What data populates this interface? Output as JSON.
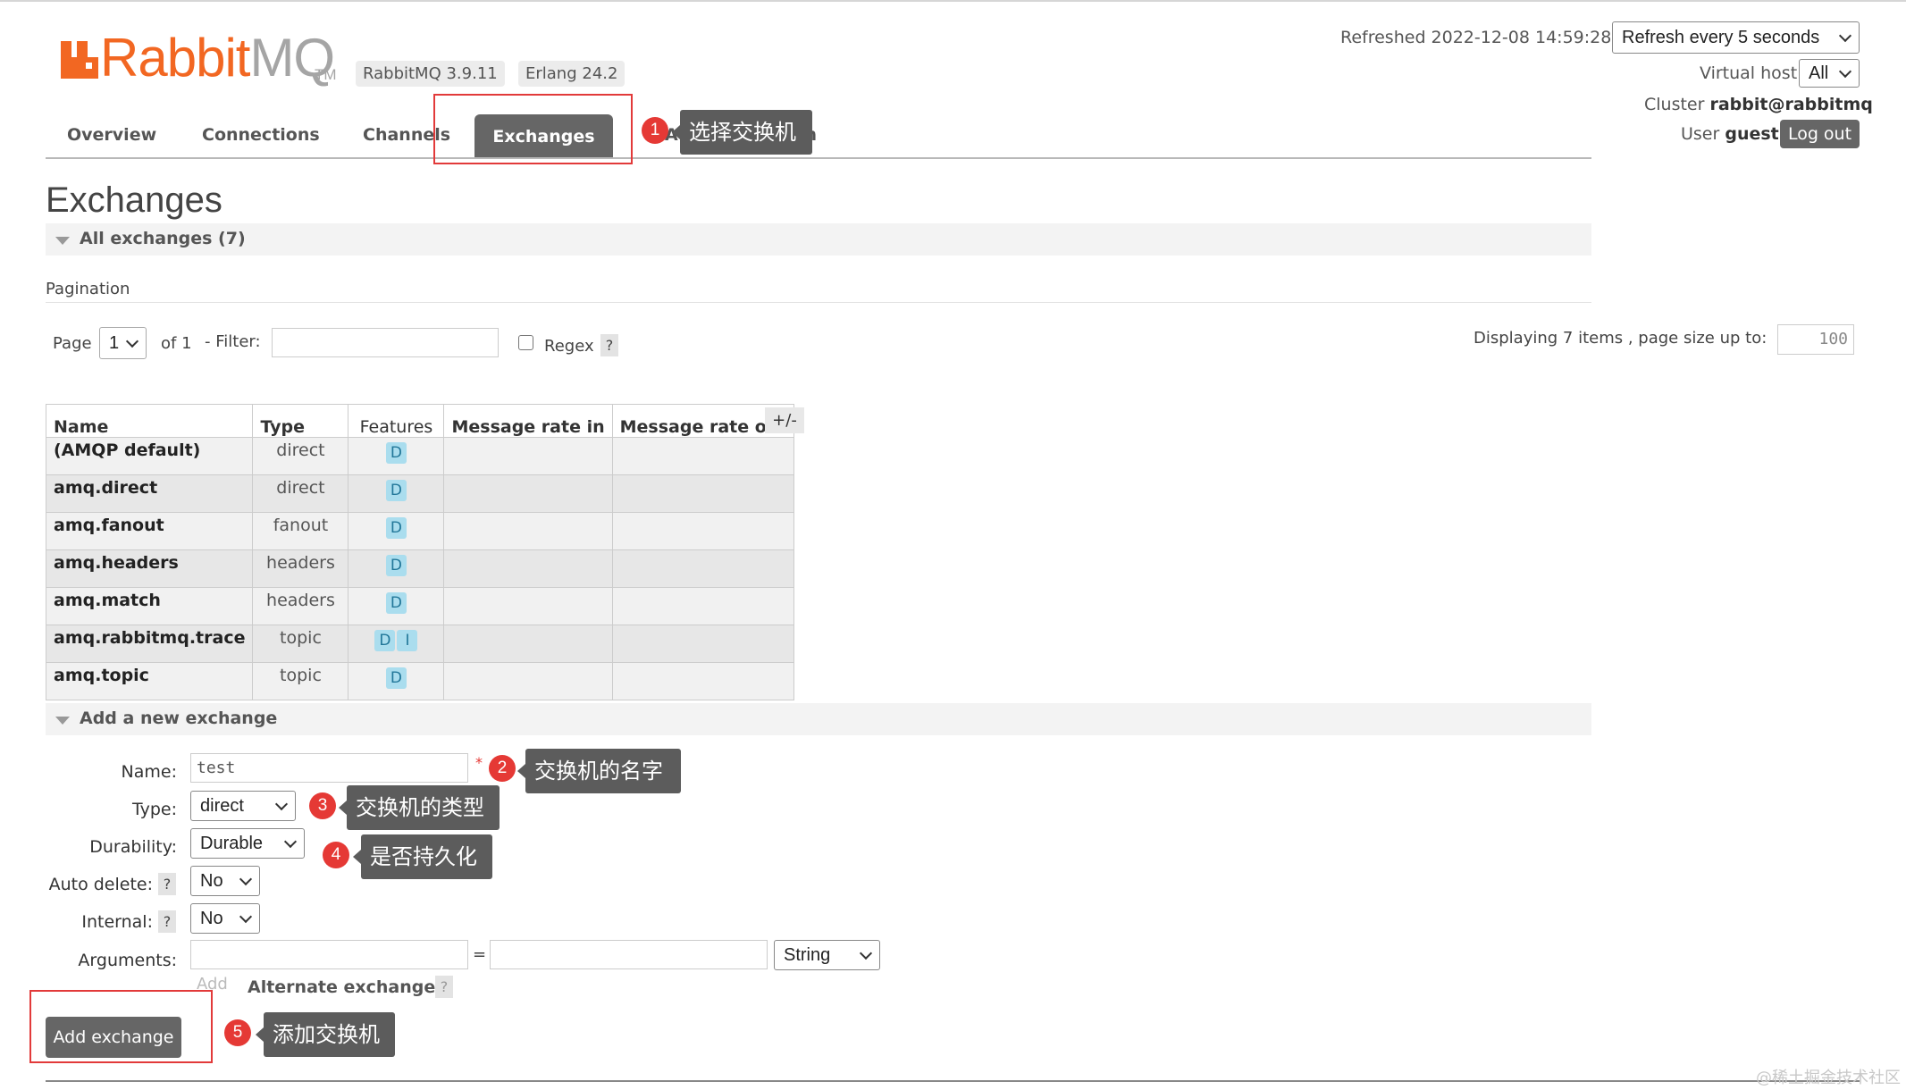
{
  "header": {
    "logo_rabbit": "Rabbit",
    "logo_mq": "MQ",
    "logo_tm": "TM",
    "version_badge": "RabbitMQ 3.9.11",
    "erlang_badge": "Erlang 24.2",
    "refreshed_label": "Refreshed 2022-12-08 14:59:28",
    "refresh_select": "Refresh every 5 seconds",
    "vhost_label": "Virtual host",
    "vhost_select": "All",
    "cluster_label": "Cluster",
    "cluster_name": "rabbit@rabbitmq",
    "user_label": "User",
    "user_name": "guest",
    "logout_label": "Log out"
  },
  "nav": {
    "overview": "Overview",
    "connections": "Connections",
    "channels": "Channels",
    "exchanges": "Exchanges",
    "admin_partial": "Ad",
    "admin_tail": "in"
  },
  "page": {
    "title": "Exchanges",
    "section_all": "All exchanges (7)",
    "pagination_label": "Pagination",
    "page_label": "Page",
    "page_value": "1",
    "of_label": "of 1",
    "filter_label": "- Filter:",
    "regex_label": "Regex",
    "help": "?",
    "displaying_label": "Displaying 7 items , page size up to:",
    "page_size": "100"
  },
  "table": {
    "headers": [
      "Name",
      "Type",
      "Features",
      "Message rate in",
      "Message rate out"
    ],
    "columns_toggle": "+/-",
    "rows": [
      {
        "name": "(AMQP default)",
        "type": "direct",
        "features": [
          "D"
        ]
      },
      {
        "name": "amq.direct",
        "type": "direct",
        "features": [
          "D"
        ]
      },
      {
        "name": "amq.fanout",
        "type": "fanout",
        "features": [
          "D"
        ]
      },
      {
        "name": "amq.headers",
        "type": "headers",
        "features": [
          "D"
        ]
      },
      {
        "name": "amq.match",
        "type": "headers",
        "features": [
          "D"
        ]
      },
      {
        "name": "amq.rabbitmq.trace",
        "type": "topic",
        "features": [
          "D",
          "I"
        ]
      },
      {
        "name": "amq.topic",
        "type": "topic",
        "features": [
          "D"
        ]
      }
    ]
  },
  "form": {
    "section_title": "Add a new exchange",
    "name_label": "Name:",
    "name_value": "test",
    "required_mark": "*",
    "type_label": "Type:",
    "type_value": "direct",
    "durability_label": "Durability:",
    "durability_value": "Durable",
    "auto_delete_label": "Auto delete:",
    "auto_delete_value": "No",
    "internal_label": "Internal:",
    "internal_value": "No",
    "arguments_label": "Arguments:",
    "equals": "=",
    "arg_type_value": "String",
    "add_label": "Add",
    "alternate_label": "Alternate exchange",
    "submit_label": "Add exchange"
  },
  "annotations": [
    {
      "num": "1",
      "text": "选择交换机"
    },
    {
      "num": "2",
      "text": "交换机的名字"
    },
    {
      "num": "3",
      "text": "交换机的类型"
    },
    {
      "num": "4",
      "text": "是否持久化"
    },
    {
      "num": "5",
      "text": "添加交换机"
    }
  ],
  "watermark": "@稀土掘金技术社区",
  "colors": {
    "brand_orange": "#f26722",
    "annotation_red": "#e53935",
    "feature_pill": "#aaddee",
    "dark_button": "#666666"
  }
}
